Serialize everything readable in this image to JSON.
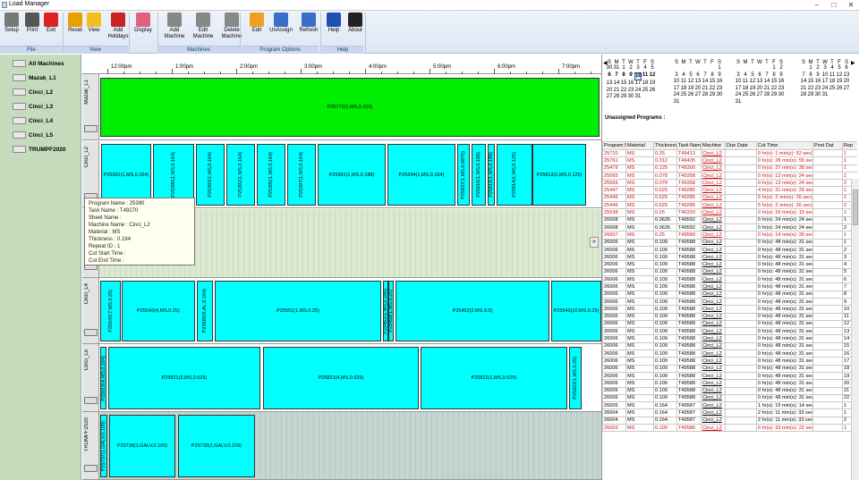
{
  "window": {
    "title": "Load Manager"
  },
  "toolbar": [
    {
      "label": "Setup",
      "color": "#777"
    },
    {
      "label": "Print",
      "color": "#555"
    },
    {
      "label": "Exit",
      "color": "#d22"
    },
    {
      "label": "Reset",
      "color": "#e8a000"
    },
    {
      "label": "View",
      "color": "#f0c020"
    },
    {
      "label": "Add Holidays",
      "color": "#c22"
    },
    {
      "label": "Display",
      "color": "#e06080"
    },
    {
      "label": "Add Machine",
      "color": "#888"
    },
    {
      "label": "Edit Machine",
      "color": "#888"
    },
    {
      "label": "Delete Machine",
      "color": "#888"
    },
    {
      "label": "Edit",
      "color": "#f0a020"
    },
    {
      "label": "UnAssign",
      "color": "#3a6fc8"
    },
    {
      "label": "Refresh",
      "color": "#3a6fc8"
    },
    {
      "label": "Help",
      "color": "#2050b0"
    },
    {
      "label": "About",
      "color": "#222"
    }
  ],
  "groups": {
    "file": "File",
    "view": "View",
    "machines": "Machines",
    "program": "Program Options",
    "help": "Help"
  },
  "machines": [
    "All Machines",
    "Mazak_L1",
    "Cinci_L2",
    "Cinci_L3",
    "Cinci_L4",
    "Cinci_L5",
    "TRUMPF2020"
  ],
  "timeline": [
    "12:00pm",
    "1:00pm",
    "2:00pm",
    "3:00pm",
    "4:00pm",
    "5:00pm",
    "6:00pm",
    "7:00pm"
  ],
  "lanes": {
    "mazak": {
      "name": "Mazak_L1",
      "blocks": [
        "P25772(1,MS,0.109)"
      ]
    },
    "l2": {
      "name": "Cinci_L2",
      "blocks": [
        "P25391(1,MS,0.164)",
        "P25390(1,MS,0.164)",
        "P25393(1,MS,0.164)",
        "P25392(1,MS,0.164)",
        "P25395(1,MS,0.164)",
        "P25397(1,MS,0.164)",
        "P25951(1,MS,0.188)",
        "P25394(1,MS,0.164)",
        "P25637(1,MS,0.0875)",
        "P25816(1,MS,0.188)",
        "P25819(1,MS,0.188)",
        "P25814(1,MS,0.125)",
        "P25813(1,MS,0.125)"
      ]
    },
    "l4": {
      "name": "Cinci_L4",
      "blocks": [
        "P25543(7,MS,0.25)",
        "P25543(4,MS,0.25)",
        "P25680(9,AL,0.164)",
        "P25551(1,MS,0.25)",
        "P25462(1,MS,0.188)",
        "P25458(1,MS,0.25)",
        "P25452(2,MS,0.5)",
        "P25543(10,MS,0.25)"
      ]
    },
    "l5": {
      "name": "Cinci_L5",
      "blocks": [
        "P25819(4,MS,0.164)",
        "P25821(3,MS,0.625)",
        "P25821(4,MS,0.625)",
        "P25822(1,MS,0.625)",
        "P25822(1,MS,0.25)"
      ]
    },
    "trumpf": {
      "name": "TRUMPF2020",
      "blocks": [
        "P25737(1,GALV,0.109)",
        "P25738(1,GALV,0.109)",
        "P25739(1,GALV,0.109)"
      ]
    }
  },
  "tooltip": {
    "program": "Program Name : 25390",
    "task": "Task Name : T49270",
    "sheet": "Sheet Name :",
    "machine": "Machine Name : Cinci_L2",
    "material": "Material : MS",
    "thickness": "Thickness : 0.164",
    "repeat": "Repeat ID : 1",
    "start": "Cut Start Time :",
    "end": "Cut End Time :"
  },
  "calendar": {
    "headers": [
      "S",
      "M",
      "T",
      "W",
      "T",
      "F",
      "S"
    ],
    "months": [
      [
        [
          "30",
          "31",
          "1",
          "2",
          "3",
          "4",
          "5"
        ],
        [
          "6",
          "7",
          "8",
          "9",
          "10",
          "11",
          "12"
        ],
        [
          "13",
          "14",
          "15",
          "16",
          "17",
          "18",
          "19"
        ],
        [
          "20",
          "21",
          "22",
          "23",
          "24",
          "25",
          "26"
        ],
        [
          "27",
          "28",
          "29",
          "30",
          "31",
          "",
          ""
        ]
      ],
      [
        [
          "",
          "",
          "",
          "",
          "",
          "",
          "1"
        ],
        [
          "3",
          "4",
          "5",
          "6",
          "7",
          "8",
          "9"
        ],
        [
          "10",
          "11",
          "12",
          "13",
          "14",
          "15",
          "16"
        ],
        [
          "17",
          "18",
          "19",
          "20",
          "21",
          "22",
          "23"
        ],
        [
          "24",
          "25",
          "26",
          "27",
          "28",
          "29",
          "30"
        ],
        [
          "31",
          "",
          "",
          "",
          "",
          "",
          ""
        ]
      ],
      [
        [
          "",
          "",
          "",
          "",
          "",
          "1",
          "2"
        ],
        [
          "3",
          "4",
          "5",
          "6",
          "7",
          "8",
          "9"
        ],
        [
          "10",
          "11",
          "12",
          "13",
          "14",
          "15",
          "16"
        ],
        [
          "17",
          "18",
          "19",
          "20",
          "21",
          "22",
          "23"
        ],
        [
          "24",
          "25",
          "26",
          "27",
          "28",
          "29",
          "30"
        ],
        [
          "31",
          "",
          "",
          "",
          "",
          "",
          ""
        ]
      ],
      [
        [
          "",
          "1",
          "2",
          "3",
          "4",
          "5",
          "6"
        ],
        [
          "7",
          "8",
          "9",
          "10",
          "11",
          "12",
          "13"
        ],
        [
          "14",
          "15",
          "16",
          "17",
          "18",
          "19",
          "20"
        ],
        [
          "21",
          "22",
          "23",
          "24",
          "25",
          "26",
          "27"
        ],
        [
          "28",
          "29",
          "30",
          "31",
          "",
          "",
          ""
        ]
      ]
    ]
  },
  "unassigned": {
    "label": "Unassigned Programs :",
    "headers": [
      "Program N",
      "Material",
      "Thickness",
      "Task Name",
      "Machine",
      "Due Date",
      "Cut Time",
      "Post Dat",
      "Rep"
    ],
    "rows": [
      [
        "25710",
        "MS",
        "0.25",
        "T49413",
        "Cinci_L2",
        "",
        "0 hr(s): 1 min(s): 52 sec(",
        "",
        "1",
        1
      ],
      [
        "25761",
        "MS",
        "0.312",
        "T49435",
        "Cinci_L2",
        "",
        "0 hr(s): 28 min(s): 55 sec(",
        "",
        "1",
        1
      ],
      [
        "25479",
        "MS",
        "0.125",
        "T49300",
        "Cinci_L2",
        "",
        "0 hr(s): 37 min(s): 39 sec(",
        "",
        "1",
        1
      ],
      [
        "25565",
        "MS",
        "0.078",
        "T49358",
        "Cinci_L2",
        "",
        "0 hr(s): 13 min(s): 24 sec(",
        "",
        "1",
        1
      ],
      [
        "25565",
        "MS",
        "0.078",
        "T49358",
        "Cinci_L2",
        "",
        "0 hr(s): 13 min(s): 24 sec(",
        "",
        "2",
        1
      ],
      [
        "25447",
        "MS",
        "0.625",
        "T49285",
        "Cinci_L2",
        "",
        "4 hr(s): 31 min(s): 29 sec(",
        "",
        "1",
        1
      ],
      [
        "25446",
        "MS",
        "0.625",
        "T49285",
        "Cinci_L2",
        "",
        "5 hr(s): 2 min(s): 26 sec(",
        "",
        "1",
        1
      ],
      [
        "25446",
        "MS",
        "0.625",
        "T49285",
        "Cinci_L2",
        "",
        "5 hr(s): 2 min(s): 26 sec(",
        "",
        "2",
        1
      ],
      [
        "25538",
        "MS",
        "0.25",
        "T49333",
        "Cinci_L2",
        "",
        "0 hr(s): 16 min(s): 15 sec(",
        "",
        "1",
        1
      ],
      [
        "26008",
        "MS",
        "0.0635",
        "T49592",
        "Cinci_L2",
        "",
        "0 hr(s): 24 min(s): 24 sec(",
        "",
        "1",
        0
      ],
      [
        "26008",
        "MS",
        "0.0635",
        "T49592",
        "Cinci_L2",
        "",
        "0 hr(s): 24 min(s): 24 sec(",
        "",
        "2",
        0
      ],
      [
        "26007",
        "MS",
        "0.25",
        "T49589",
        "Cinci_L2",
        "",
        "0 hr(s): 14 min(s): 30 sec(",
        "",
        "1",
        1
      ],
      [
        "26006",
        "MS",
        "0.109",
        "T49588",
        "Cinci_L2",
        "",
        "0 hr(s): 48 min(s): 31 sec(",
        "",
        "1",
        0
      ],
      [
        "26006",
        "MS",
        "0.109",
        "T49588",
        "Cinci_L2",
        "",
        "0 hr(s): 48 min(s): 31 sec(",
        "",
        "2",
        0
      ],
      [
        "26006",
        "MS",
        "0.109",
        "T49588",
        "Cinci_L2",
        "",
        "0 hr(s): 48 min(s): 31 sec(",
        "",
        "3",
        0
      ],
      [
        "26006",
        "MS",
        "0.109",
        "T49588",
        "Cinci_L2",
        "",
        "0 hr(s): 48 min(s): 31 sec(",
        "",
        "4",
        0
      ],
      [
        "26006",
        "MS",
        "0.109",
        "T49588",
        "Cinci_L2",
        "",
        "0 hr(s): 48 min(s): 31 sec(",
        "",
        "5",
        0
      ],
      [
        "26006",
        "MS",
        "0.109",
        "T49588",
        "Cinci_L2",
        "",
        "0 hr(s): 48 min(s): 31 sec(",
        "",
        "6",
        0
      ],
      [
        "26006",
        "MS",
        "0.109",
        "T49588",
        "Cinci_L2",
        "",
        "0 hr(s): 48 min(s): 31 sec(",
        "",
        "7",
        0
      ],
      [
        "26006",
        "MS",
        "0.109",
        "T49588",
        "Cinci_L2",
        "",
        "0 hr(s): 48 min(s): 31 sec(",
        "",
        "8",
        0
      ],
      [
        "26006",
        "MS",
        "0.109",
        "T49588",
        "Cinci_L2",
        "",
        "0 hr(s): 48 min(s): 31 sec(",
        "",
        "9",
        0
      ],
      [
        "26006",
        "MS",
        "0.109",
        "T49588",
        "Cinci_L2",
        "",
        "0 hr(s): 48 min(s): 31 sec(",
        "",
        "10",
        0
      ],
      [
        "26006",
        "MS",
        "0.109",
        "T49588",
        "Cinci_L2",
        "",
        "0 hr(s): 48 min(s): 31 sec(",
        "",
        "11",
        0
      ],
      [
        "26006",
        "MS",
        "0.109",
        "T49588",
        "Cinci_L2",
        "",
        "0 hr(s): 48 min(s): 31 sec(",
        "",
        "12",
        0
      ],
      [
        "26006",
        "MS",
        "0.109",
        "T49588",
        "Cinci_L2",
        "",
        "0 hr(s): 48 min(s): 31 sec(",
        "",
        "13",
        0
      ],
      [
        "26006",
        "MS",
        "0.109",
        "T49588",
        "Cinci_L2",
        "",
        "0 hr(s): 48 min(s): 31 sec(",
        "",
        "14",
        0
      ],
      [
        "26006",
        "MS",
        "0.109",
        "T49588",
        "Cinci_L2",
        "",
        "0 hr(s): 48 min(s): 31 sec(",
        "",
        "15",
        0
      ],
      [
        "26006",
        "MS",
        "0.109",
        "T49588",
        "Cinci_L2",
        "",
        "0 hr(s): 48 min(s): 31 sec(",
        "",
        "16",
        0
      ],
      [
        "26006",
        "MS",
        "0.109",
        "T49588",
        "Cinci_L2",
        "",
        "0 hr(s): 48 min(s): 31 sec(",
        "",
        "17",
        0
      ],
      [
        "26006",
        "MS",
        "0.109",
        "T49588",
        "Cinci_L2",
        "",
        "0 hr(s): 48 min(s): 31 sec(",
        "",
        "18",
        0
      ],
      [
        "26006",
        "MS",
        "0.109",
        "T49588",
        "Cinci_L2",
        "",
        "0 hr(s): 48 min(s): 31 sec(",
        "",
        "19",
        0
      ],
      [
        "26006",
        "MS",
        "0.109",
        "T49588",
        "Cinci_L2",
        "",
        "0 hr(s): 48 min(s): 31 sec(",
        "",
        "20",
        0
      ],
      [
        "26006",
        "MS",
        "0.109",
        "T49588",
        "Cinci_L2",
        "",
        "0 hr(s): 48 min(s): 31 sec(",
        "",
        "21",
        0
      ],
      [
        "26006",
        "MS",
        "0.109",
        "T49588",
        "Cinci_L2",
        "",
        "0 hr(s): 48 min(s): 31 sec(",
        "",
        "22",
        0
      ],
      [
        "26005",
        "MS",
        "0.164",
        "T49587",
        "Cinci_L2",
        "",
        "1 hr(s): 15 min(s): 14 sec(",
        "",
        "1",
        0
      ],
      [
        "26004",
        "MS",
        "0.164",
        "T49587",
        "Cinci_L2",
        "",
        "2 hr(s): 11 min(s): 33 sec(",
        "",
        "1",
        0
      ],
      [
        "26004",
        "MS",
        "0.164",
        "T49587",
        "Cinci_L2",
        "",
        "2 hr(s): 11 min(s): 33 sec(",
        "",
        "2",
        0
      ],
      [
        "26003",
        "MS",
        "0.109",
        "T49586",
        "Cinci_L2",
        "",
        "0 hr(s): 33 min(s): 22 sec(",
        "",
        "1",
        1
      ]
    ]
  }
}
